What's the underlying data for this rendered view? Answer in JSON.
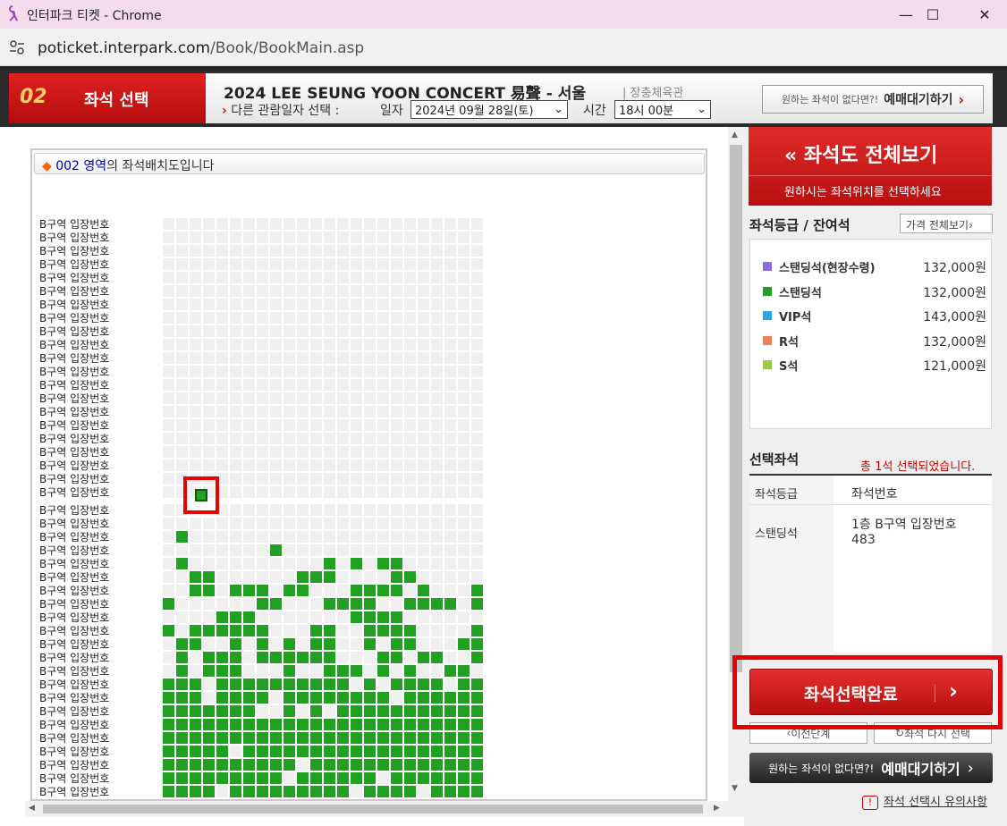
{
  "window": {
    "title": "인터파크 티켓 - Chrome",
    "minimize": "—",
    "maximize": "☐",
    "close": "✕"
  },
  "address": {
    "host": "poticket.interpark.com",
    "path": "/Book/BookMain.asp"
  },
  "header": {
    "step_number": "02",
    "step_label": "좌석 선택",
    "concert_title": "2024 LEE SEUNG YOON CONCERT 易聲 - 서울",
    "venue": "| 장충체육관",
    "other_date_label": "다른 관람일자 선택 :",
    "date_label": "일자",
    "date_value": "2024년 09월 28일(토)",
    "time_label": "시간",
    "time_value": "18시 00분",
    "wait_prefix": "원하는 좌석이 없다면?!",
    "wait_label": "예매대기하기"
  },
  "map": {
    "zone": "002 영역",
    "title_suffix": "의 좌석배치도입니다",
    "row_label": "B구역 입장번호",
    "row_count": 43
  },
  "right": {
    "fullview_title": "좌석도 전체보기",
    "fullview_sub": "원하시는 좌석위치를 선택하세요",
    "grade_header": "좌석등급 / 잔여석",
    "price_button": "가격 전체보기",
    "grades": [
      {
        "name": "스탠딩석(현장수령)",
        "price": "132,000원",
        "color": "#8a6be0"
      },
      {
        "name": "스탠딩석",
        "price": "132,000원",
        "color": "#21a021"
      },
      {
        "name": "VIP석",
        "price": "143,000원",
        "color": "#2aa7e8"
      },
      {
        "name": "R석",
        "price": "132,000원",
        "color": "#f08050"
      },
      {
        "name": "S석",
        "price": "121,000원",
        "color": "#9ccc44"
      }
    ],
    "selected_header": "선택좌석",
    "selected_count": "총 1석 선택되었습니다.",
    "table_header_grade": "좌석등급",
    "table_header_seat": "좌석번호",
    "selected_grade": "스탠딩석",
    "selected_seat_line1": "1층 B구역 입장번호",
    "selected_seat_line2": "483",
    "done_button": "좌석선택완료",
    "prev_button": "이전단계",
    "reset_button": "좌석 다시 선택",
    "wait_prefix": "원하는 좌석이 없다면?!",
    "wait_label": "예매대기하기",
    "notice": "좌석 선택시 유의사항"
  },
  "colors": {
    "available": "#21a021",
    "sold": "#efefef",
    "accent": "#d01818"
  }
}
